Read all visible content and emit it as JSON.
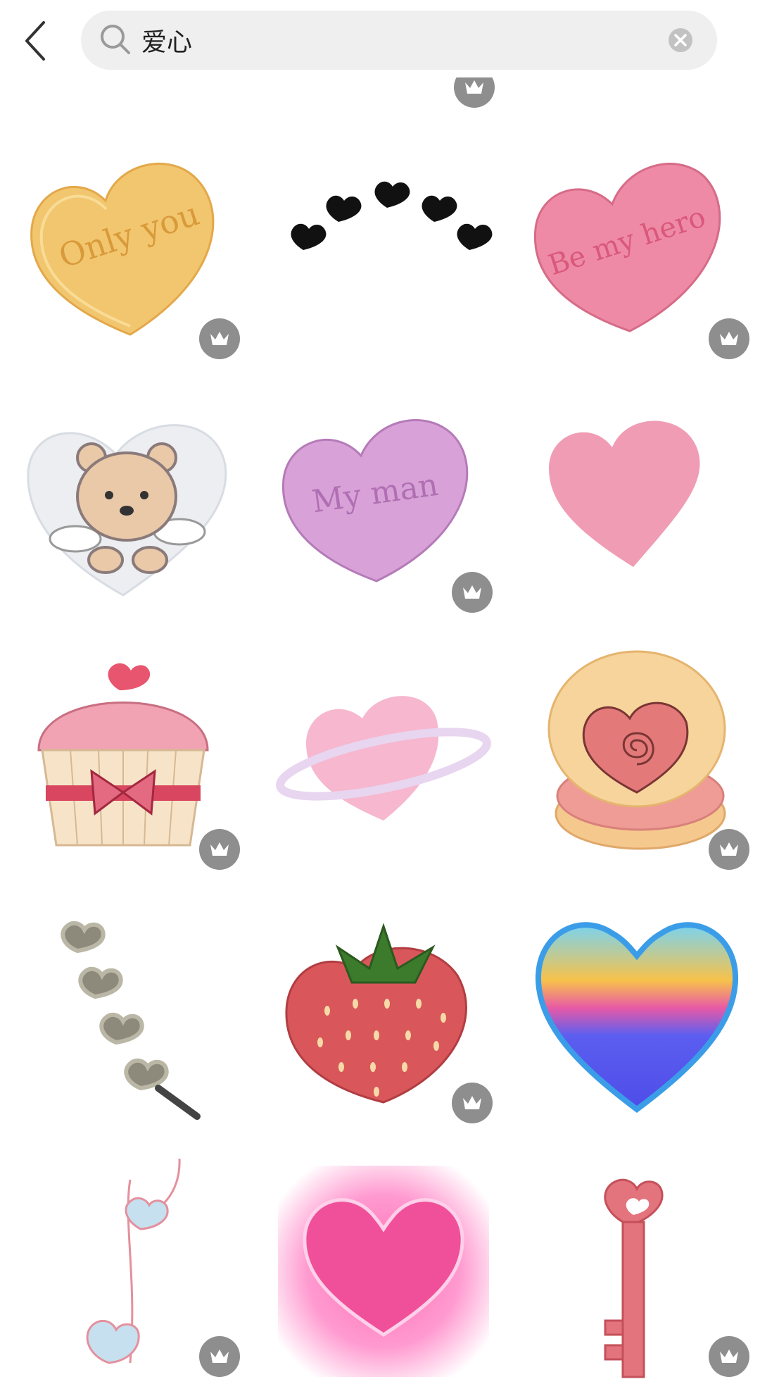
{
  "search": {
    "query": "爱心"
  },
  "stickers": [
    {
      "name": "only-you-candy-heart",
      "text": "Only you",
      "premium": true
    },
    {
      "name": "black-hearts-arc",
      "premium": false
    },
    {
      "name": "be-my-hero-candy-heart",
      "text": "Be my hero",
      "premium": true
    },
    {
      "name": "teddy-bear-heart",
      "premium": false
    },
    {
      "name": "my-man-candy-heart",
      "text": "My man",
      "premium": true
    },
    {
      "name": "pink-brush-heart",
      "premium": false
    },
    {
      "name": "heart-cupcake",
      "premium": true
    },
    {
      "name": "heart-planet",
      "premium": false
    },
    {
      "name": "swirl-heart-cookie",
      "premium": true
    },
    {
      "name": "heart-hair-clip",
      "premium": false
    },
    {
      "name": "strawberry-heart",
      "premium": true
    },
    {
      "name": "holographic-blue-heart",
      "premium": false
    },
    {
      "name": "music-note-hearts",
      "premium": true
    },
    {
      "name": "glowing-pink-heart",
      "premium": false
    },
    {
      "name": "heart-key",
      "premium": true
    }
  ],
  "colors": {
    "search_bg": "#efefef",
    "crown_badge": "#8e8e8e"
  }
}
